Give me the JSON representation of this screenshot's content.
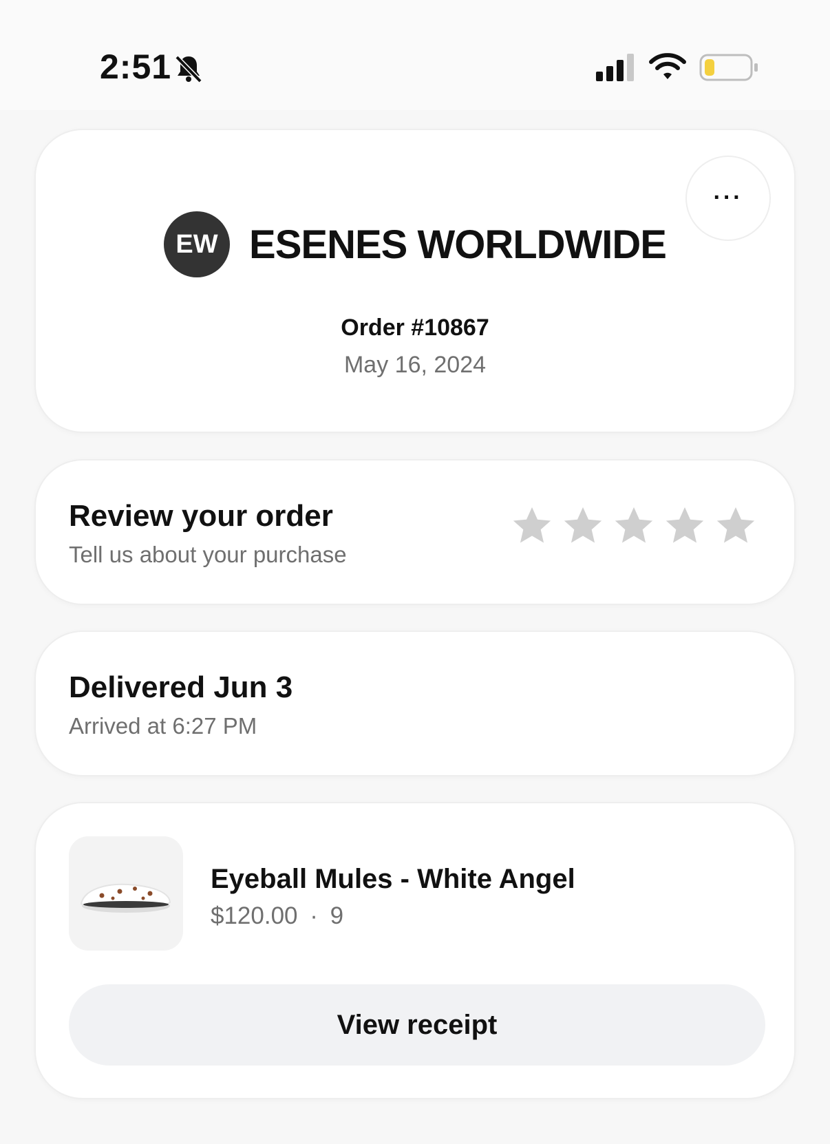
{
  "status_bar": {
    "time": "2:51",
    "icons": [
      "bell-slash-icon",
      "cellular-signal-icon",
      "wifi-icon",
      "battery-low-icon"
    ],
    "battery_color": "#f4d03f"
  },
  "order_header": {
    "more_label": "···",
    "merchant_initials": "EW",
    "merchant_name": "ESENES WORLDWIDE",
    "order_number": "Order #10867",
    "order_date": "May 16, 2024"
  },
  "review": {
    "title": "Review your order",
    "subtitle": "Tell us about your purchase",
    "rating": 0,
    "max_rating": 5,
    "star_color": "#cfcfcf"
  },
  "delivery": {
    "title": "Delivered Jun 3",
    "subtitle": "Arrived at 6:27 PM"
  },
  "item": {
    "name": "Eyeball Mules - White Angel",
    "price": "$120.00",
    "size": "9",
    "separator": "·",
    "receipt_button": "View receipt"
  }
}
